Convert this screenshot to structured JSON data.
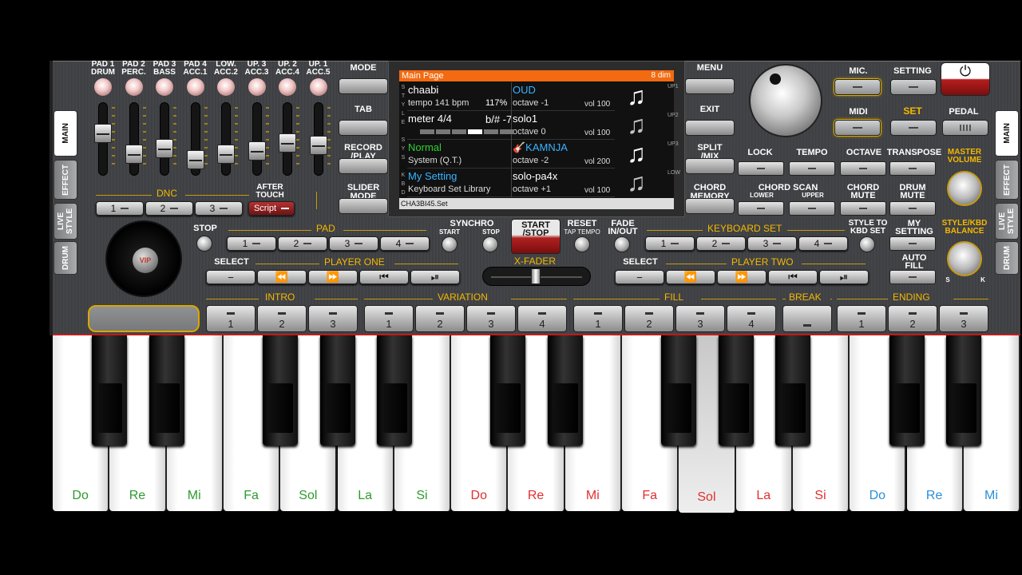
{
  "mixer": {
    "channels": [
      {
        "label": "PAD 1\nDRUM",
        "level": 0.62
      },
      {
        "label": "PAD 2\nPERC.",
        "level": 0.25
      },
      {
        "label": "PAD 3\nBASS",
        "level": 0.35
      },
      {
        "label": "PAD 4\nACC.1",
        "level": 0.15
      },
      {
        "label": "LOW.\nACC.2",
        "level": 0.25
      },
      {
        "label": "UP. 3\nACC.3",
        "level": 0.3
      },
      {
        "label": "UP. 2\nACC.4",
        "level": 0.45
      },
      {
        "label": "UP. 1\nACC.5",
        "level": 0.4
      }
    ]
  },
  "dnc": {
    "title": "DNC",
    "after_touch": "AFTER\nTOUCH",
    "buttons": [
      "1",
      "2",
      "3"
    ],
    "script": "Script"
  },
  "side_tabs_left": [
    "MAIN",
    "EFFECT",
    "LIVE\nSTYLE",
    "DRUM"
  ],
  "side_tabs_right": [
    "MAIN",
    "EFFECT",
    "LIVE\nSTYLE",
    "DRUM"
  ],
  "left_menu": [
    "MODE",
    "TAB",
    "RECORD\n/PLAY",
    "SLIDER\nMODE"
  ],
  "right_menu": [
    "MENU",
    "EXIT",
    "SPLIT\n/MIX",
    "CHORD\nMEMORY"
  ],
  "screen": {
    "header": "Main Page",
    "chord": "8 dim",
    "rows": [
      {
        "left_title": "chaabi",
        "left_color": "#ffffff",
        "left_sub": "tempo 141 bpm",
        "pct": "117%",
        "right_title": "OUD",
        "right_color": "#39b3ff",
        "octave": "octave -1",
        "vol": "vol 100",
        "side": "UP1"
      },
      {
        "left_title": "meter 4/4",
        "left_color": "#ffffff",
        "left_sub": "",
        "pct": "b/# -7",
        "right_title": "solo1",
        "right_color": "#ffffff",
        "octave": "octave 0",
        "vol": "vol 100",
        "side": "UP2"
      },
      {
        "left_title": "Normal",
        "left_color": "#2fd12f",
        "left_sub": "System (Q.T.)",
        "pct": "",
        "right_title": "🎸KAMNJA",
        "right_color": "#39b3ff",
        "octave": "octave -2",
        "vol": "vol 200",
        "side": "UP3"
      },
      {
        "left_title": "My Setting",
        "left_color": "#39b3ff",
        "left_sub": "Keyboard Set Library",
        "pct": "",
        "right_title": "solo-pa4x",
        "right_color": "#ffffff",
        "octave": "octave +1",
        "vol": "vol 100",
        "side": "LOW"
      }
    ],
    "left_side_letters": [
      "S",
      "T",
      "Y",
      "L",
      "E",
      "",
      "S",
      "Y",
      "S",
      "",
      "K",
      "B",
      "D"
    ],
    "footer": "CHA3BI45.Set"
  },
  "top_right": {
    "mic": "MIC.",
    "setting": "SETTING",
    "midi": "MIDI",
    "set": "SET",
    "pedal": "PEDAL",
    "power_icon": "⏻"
  },
  "controls_row": {
    "lock": "LOCK",
    "tempo": "TEMPO",
    "octave": "OCTAVE",
    "transpose": "TRANSPOSE",
    "master_volume": "MASTER\nVOLUME",
    "chord_scan": "CHORD SCAN",
    "lower": "LOWER",
    "upper": "UPPER",
    "chord_mute": "CHORD\nMUTE",
    "drum_mute": "DRUM\nMUTE"
  },
  "pad": {
    "stop": "STOP",
    "title": "PAD",
    "buttons": [
      "1",
      "2",
      "3",
      "4"
    ]
  },
  "transport": {
    "synchro": "SYNCHRO",
    "start": "START",
    "stop": "STOP",
    "start_stop": "START\n/STOP",
    "reset": "RESET",
    "tap_tempo": "TAP TEMPO",
    "fade": "FADE\nIN/OUT",
    "x_fader": "X-FADER"
  },
  "keyboard_set": {
    "title": "KEYBOARD SET",
    "buttons": [
      "1",
      "2",
      "3",
      "4"
    ],
    "style_to_kbd": "STYLE TO\nKBD SET",
    "my_setting": "MY\nSETTING",
    "auto_fill": "AUTO\nFILL",
    "balance": "STYLE/KBD\nBALANCE",
    "s": "S",
    "k": "K"
  },
  "player_one": {
    "select": "SELECT",
    "title": "PLAYER ONE"
  },
  "player_two": {
    "select": "SELECT",
    "title": "PLAYER TWO"
  },
  "sections": {
    "intro": {
      "title": "INTRO",
      "buttons": [
        "1",
        "2",
        "3"
      ]
    },
    "variation": {
      "title": "VARIATION",
      "buttons": [
        "1",
        "2",
        "3",
        "4"
      ]
    },
    "fill": {
      "title": "FILL",
      "buttons": [
        "1",
        "2",
        "3",
        "4"
      ]
    },
    "break": {
      "title": "BREAK"
    },
    "ending": {
      "title": "ENDING",
      "buttons": [
        "1",
        "2",
        "3"
      ]
    }
  },
  "keys": [
    {
      "label": "Do",
      "color": "#2e9a2e"
    },
    {
      "label": "Re",
      "color": "#2e9a2e"
    },
    {
      "label": "Mi",
      "color": "#2e9a2e"
    },
    {
      "label": "Fa",
      "color": "#2e9a2e"
    },
    {
      "label": "Sol",
      "color": "#2e9a2e"
    },
    {
      "label": "La",
      "color": "#2e9a2e"
    },
    {
      "label": "Si",
      "color": "#2e9a2e"
    },
    {
      "label": "Do",
      "color": "#e03030"
    },
    {
      "label": "Re",
      "color": "#e03030"
    },
    {
      "label": "Mi",
      "color": "#e03030"
    },
    {
      "label": "Fa",
      "color": "#e03030"
    },
    {
      "label": "Sol",
      "color": "#e03030"
    },
    {
      "label": "La",
      "color": "#e03030"
    },
    {
      "label": "Si",
      "color": "#e03030"
    },
    {
      "label": "Do",
      "color": "#2a8fd8"
    },
    {
      "label": "Re",
      "color": "#2a8fd8"
    },
    {
      "label": "Mi",
      "color": "#2a8fd8"
    }
  ],
  "pressed_key": 11
}
